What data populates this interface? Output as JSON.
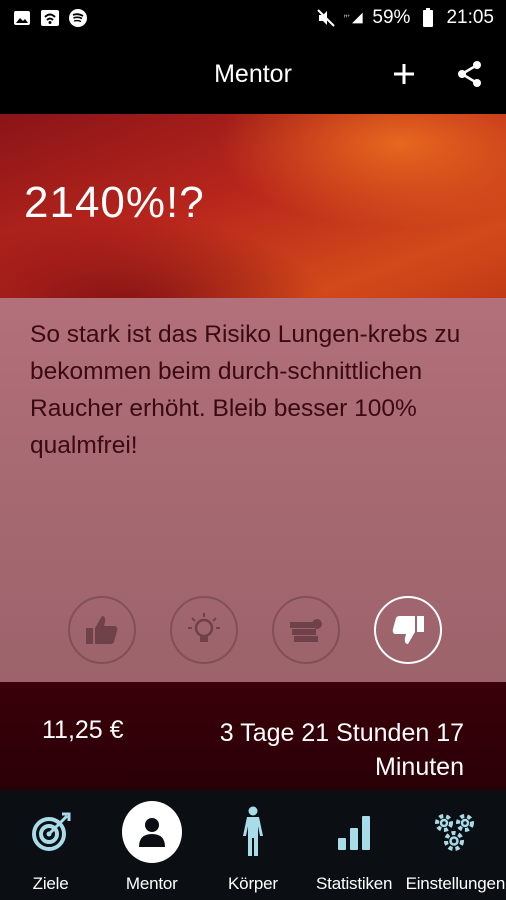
{
  "status_bar": {
    "battery": "59%",
    "time": "21:05",
    "icons": [
      "image-icon",
      "wifi-icon",
      "spotify-icon",
      "mute-icon",
      "signal-icon",
      "battery-icon"
    ]
  },
  "app_bar": {
    "title": "Mentor",
    "actions": [
      "add-icon",
      "share-icon"
    ]
  },
  "hero": {
    "title": "2140%!?"
  },
  "content": {
    "message": "So stark ist das Risiko Lungen-krebs zu bekommen beim durch-schnittlichen Raucher erhöht. Bleib besser 100% qualmfrei!",
    "reactions": [
      {
        "icon": "thumbs-up-icon",
        "active": false
      },
      {
        "icon": "lightbulb-icon",
        "active": false
      },
      {
        "icon": "money-icon",
        "active": false
      },
      {
        "icon": "thumbs-down-icon",
        "active": true
      }
    ]
  },
  "stats": {
    "money": "11,25 €",
    "duration": "3 Tage 21 Stunden 17 Minuten"
  },
  "bottom_nav": {
    "items": [
      {
        "label": "Ziele",
        "icon": "target-icon"
      },
      {
        "label": "Mentor",
        "icon": "person-icon",
        "active": true
      },
      {
        "label": "Körper",
        "icon": "body-icon"
      },
      {
        "label": "Statistiken",
        "icon": "bar-chart-icon"
      },
      {
        "label": "Einstellungen",
        "icon": "gears-icon"
      }
    ]
  },
  "colors": {
    "hero_red": "#b8261c",
    "content_pink": "#b3707a",
    "stats_dark": "#3b0009",
    "nav_icon": "#a8dce8"
  }
}
